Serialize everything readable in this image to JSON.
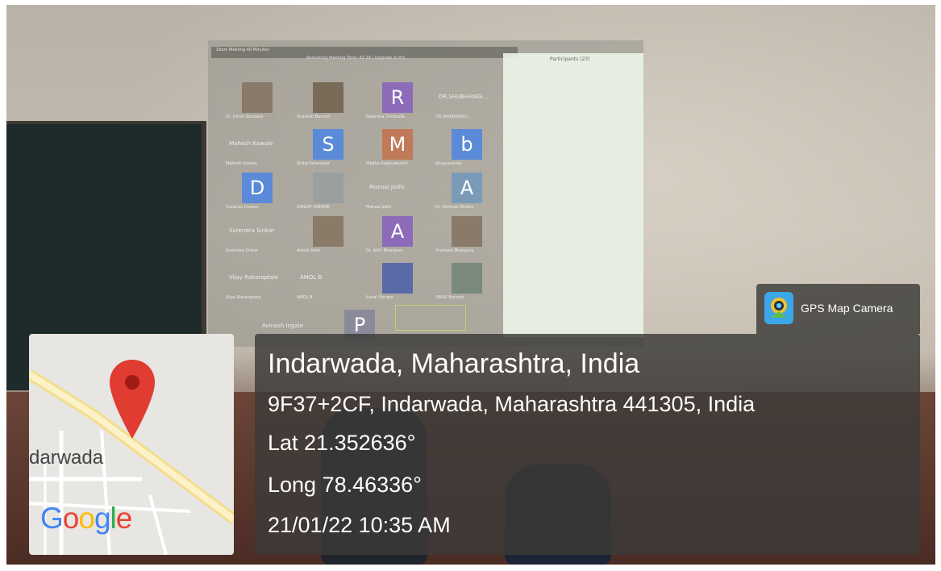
{
  "photo": {
    "zoom_window": {
      "title": "Zoom Meeting 40-Minutes",
      "timer": "Remaining Meeting Time: 43:39 | Upgrade to Pro",
      "panel_title": "Participants (23)"
    },
    "tiles": [
      {
        "letter": "",
        "name": "Dr. Girish Korrewar",
        "color": "#8a7a6a"
      },
      {
        "letter": "",
        "name": "Shailesh Bansod",
        "color": "#7a6a58"
      },
      {
        "letter": "R",
        "name": "Rajendra Dhotpalle",
        "color": "#8c6bb8"
      },
      {
        "letter": "",
        "name": "DR.SHUBHANGI...",
        "color": ""
      },
      {
        "letter": "",
        "name": "Mahesh Kawale",
        "color": ""
      },
      {
        "letter": "S",
        "name": "Shital Kotamwar",
        "color": "#5a8ad8"
      },
      {
        "letter": "M",
        "name": "Megha Raghuwanshi",
        "color": "#c07a58"
      },
      {
        "letter": "b",
        "name": "bhagyashree",
        "color": "#5a8ad8"
      },
      {
        "letter": "D",
        "name": "Dadarao Dopkar",
        "color": "#5a8ad8"
      },
      {
        "letter": "",
        "name": "SANDIP SHENDE",
        "color": "#9aa0a0"
      },
      {
        "letter": "",
        "name": "Manasi Joshi",
        "color": ""
      },
      {
        "letter": "A",
        "name": "Dr. Abhinav Bhatte",
        "color": "#7a9ab8"
      },
      {
        "letter": "",
        "name": "Surendra Sinkar",
        "color": ""
      },
      {
        "letter": "",
        "name": "Ashish Kale",
        "color": "#8a7a68"
      },
      {
        "letter": "A",
        "name": "Dr. Aditi Bhargava",
        "color": "#8c6bb8"
      },
      {
        "letter": "",
        "name": "Prashant Bhargava",
        "color": "#8a7a6a"
      },
      {
        "letter": "",
        "name": "Vijay Rahangdale",
        "color": ""
      },
      {
        "letter": "",
        "name": "AMOL B",
        "color": ""
      },
      {
        "letter": "",
        "name": "Kunal Dongre",
        "color": "#5a6aa8"
      },
      {
        "letter": "",
        "name": "VIKAS Bansod",
        "color": "#7a8a7a"
      }
    ],
    "bottom_tile": "Avinash Ingale",
    "bottom_letter": "P"
  },
  "map": {
    "town": "darwada",
    "logo": "Google"
  },
  "gps_badge": {
    "label": "GPS Map Camera"
  },
  "info": {
    "place": "Indarwada, Maharashtra, India",
    "address": "9F37+2CF, Indarwada, Maharashtra 441305, India",
    "lat": "Lat 21.352636°",
    "long": "Long 78.46336°",
    "datetime": "21/01/22 10:35 AM"
  },
  "colors": {
    "info_bg": "#3c3a38",
    "pin_red": "#e03c31",
    "google_blue": "#4285f4",
    "google_red": "#ea4335",
    "google_yellow": "#fbbc05",
    "google_green": "#34a853"
  }
}
